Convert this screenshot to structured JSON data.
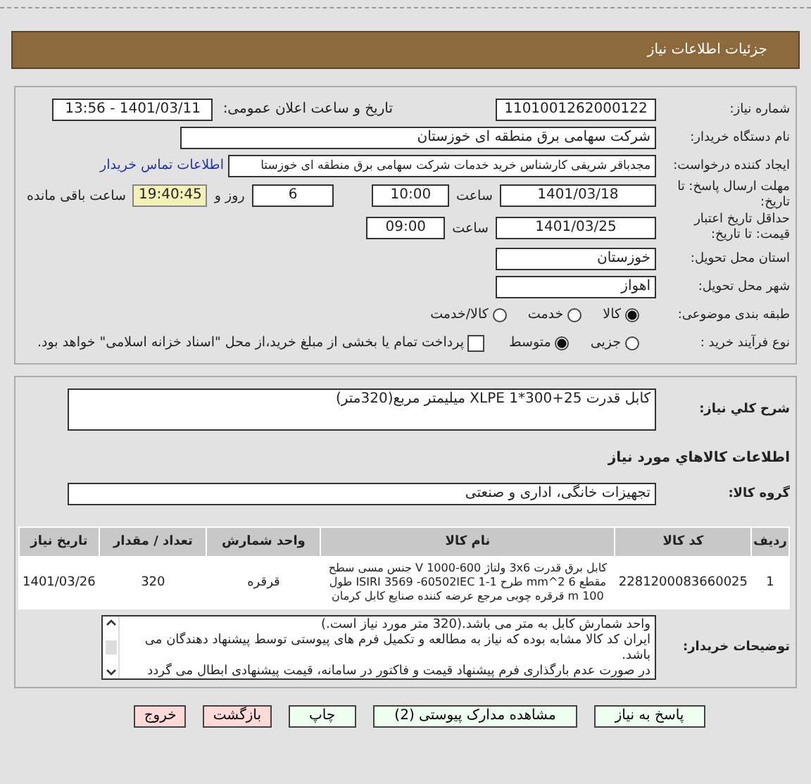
{
  "header": {
    "title": "جزئیات اطلاعات نیاز"
  },
  "need_number": {
    "label": "شماره نیاز:",
    "value": "1101001262000122"
  },
  "announce": {
    "label": "تاریخ و ساعت اعلان عمومی:",
    "value": "1401/03/11 - 13:56"
  },
  "buyer": {
    "label": "نام دستگاه خریدار:",
    "value": "شرکت سهامی برق منطقه ای خوزستان"
  },
  "requester": {
    "label": "ایجاد کننده درخواست:",
    "value": "مجدباقر شریفی کارشناس خرید خدمات شرکت سهامی برق منطقه ای خوزستا",
    "link": "اطلاعات تماس خریدار"
  },
  "deadline": {
    "label": "مهلت ارسال پاسخ: تا تاریخ:",
    "date": "1401/03/18",
    "time_label": "ساعت",
    "time": "10:00",
    "days": "6",
    "days_label": "روز و",
    "remaining": "19:40:45",
    "remaining_label": "ساعت باقی مانده"
  },
  "validity": {
    "label": "حداقل تاریخ اعتبار قیمت: تا تاریخ:",
    "date": "1401/03/25",
    "time_label": "ساعت",
    "time": "09:00"
  },
  "province": {
    "label": "استان محل تحویل:",
    "value": "خوزستان"
  },
  "city": {
    "label": "شهر محل تحویل:",
    "value": "اهواز"
  },
  "category": {
    "label": "طبقه بندی موضوعی:",
    "options": [
      {
        "label": "کالا",
        "selected": true
      },
      {
        "label": "خدمت",
        "selected": false
      },
      {
        "label": "کالا/خدمت",
        "selected": false
      }
    ]
  },
  "process": {
    "label": "نوع فرآیند خرید :",
    "options": [
      {
        "label": "جزیی",
        "selected": false
      },
      {
        "label": "متوسط",
        "selected": true
      }
    ],
    "checkbox": {
      "label": "پرداخت تمام یا بخشی از مبلغ خرید،از محل \"اسناد خزانه اسلامی\" خواهد بود.",
      "checked": false
    }
  },
  "description": {
    "label": "شرح کلي نياز:",
    "value": "کابل قدرت 25+300*1 XLPE میلیمتر مربع(320متر)"
  },
  "goods_title": "اطلاعات کالاهاي مورد نياز",
  "goods_group": {
    "label": "گروه کالا:",
    "value": "تجهیزات خانگی، اداری و صنعتی"
  },
  "table": {
    "columns": [
      "ردیف",
      "کد کالا",
      "نام کالا",
      "واحد شمارش",
      "تعداد / مقدار",
      "تاریخ نیاز"
    ],
    "rows": [
      {
        "cells": [
          "1",
          "2281200083660025",
          "کابل برق قدرت 3x6 ولتاژ 600-1000 V جنس مسی سطح مقطع 6 2^mm طرح 1-ISIRI 3569 -60502IEC 1 طول 100 m قرقره چوبی مرجع عرضه کننده صنایع کابل کرمان",
          "قرقره",
          "320",
          "1401/03/26"
        ]
      }
    ]
  },
  "notes": {
    "label": "توضیحات خریدار:",
    "lines": [
      "واحد شمارش کابل به متر می باشد.(320 متر مورد نیاز است.)",
      "ایران کد کالا مشابه بوده که نیاز به مطالعه و تکمیل فرم های پیوستی توسط پیشنهاد دهندگان می باشد.",
      "در صورت عدم بارگذاری فرم پیشنهاد قیمت و فاکتور در سامانه، قیمت پیشنهادی ابطال می گردد"
    ]
  },
  "buttons": [
    {
      "label": "پاسخ به نیاز",
      "kind": "normal"
    },
    {
      "label": "مشاهده مدارک پیوستی (2)",
      "kind": "normal"
    },
    {
      "label": "چاپ",
      "kind": "normal"
    },
    {
      "label": "بازگشت",
      "kind": "danger"
    },
    {
      "label": "خروج",
      "kind": "danger"
    }
  ]
}
